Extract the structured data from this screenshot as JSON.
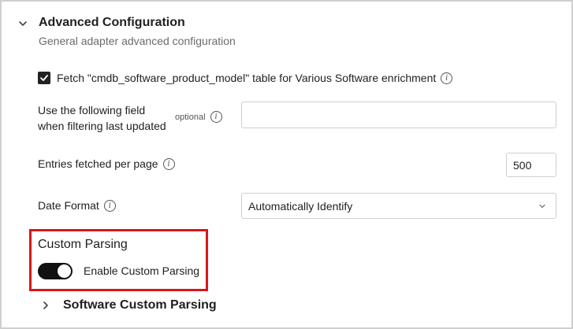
{
  "section": {
    "title": "Advanced Configuration",
    "subtitle": "General adapter advanced configuration",
    "expand_icon": "chevron-down-icon"
  },
  "fetch_option": {
    "checked": true,
    "label": "Fetch \"cmdb_software_product_model\" table for Various Software enrichment",
    "info_icon": "info-icon"
  },
  "filter_field": {
    "label_line1": "Use the following field",
    "label_line2": "when filtering last updated",
    "optional_label": "optional",
    "value": "",
    "placeholder": ""
  },
  "entries_per_page": {
    "label": "Entries fetched per page",
    "value": "500"
  },
  "date_format": {
    "label": "Date Format",
    "selected": "Automatically Identify"
  },
  "custom_parsing": {
    "title": "Custom Parsing",
    "toggle_label": "Enable Custom Parsing",
    "enabled": true,
    "highlight_color": "#d9151b"
  },
  "software_custom_parsing": {
    "title": "Software Custom Parsing",
    "expand_icon": "chevron-right-icon"
  }
}
